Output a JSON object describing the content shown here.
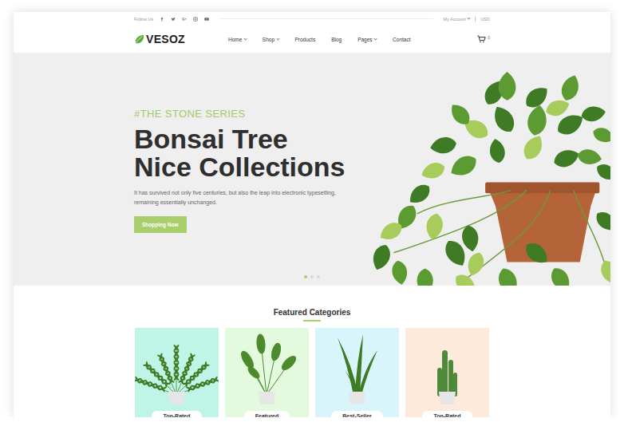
{
  "top_bar": {
    "follow_label": "Follow Us",
    "account": {
      "label": "My Account",
      "dropdown": true
    },
    "currency": "USD"
  },
  "header": {
    "logo": "VESOZ",
    "nav": [
      {
        "label": "Home",
        "dropdown": true
      },
      {
        "label": "Shop",
        "dropdown": true
      },
      {
        "label": "Products",
        "dropdown": false
      },
      {
        "label": "Blog",
        "dropdown": false
      },
      {
        "label": "Pages",
        "dropdown": true
      },
      {
        "label": "Contact",
        "dropdown": false
      }
    ],
    "cart_count": "0"
  },
  "hero": {
    "tag": "#THE STONE SERIES",
    "title_lines": [
      "Bonsai Tree",
      "Nice Collections"
    ],
    "description_lines": [
      "It has survived not only five centuries, but also the leap into electronic typesetting,",
      "remaining essentially unchanged."
    ],
    "button": "Shopping Now",
    "slides": [
      {
        "selected": true
      },
      {
        "selected": false
      },
      {
        "selected": false
      }
    ]
  },
  "featured": {
    "title": "Featured Categories",
    "categories": [
      {
        "label": "Top-Rated",
        "color": "#bff5e6",
        "kind": "palm"
      },
      {
        "label": "Featured",
        "color": "#e4fadf",
        "kind": "strelitzia"
      },
      {
        "label": "Best-Seller",
        "color": "#d8f5fc",
        "kind": "sansevieria"
      },
      {
        "label": "Top-Rated",
        "color": "#fdeadb",
        "kind": "cactus"
      }
    ]
  }
}
